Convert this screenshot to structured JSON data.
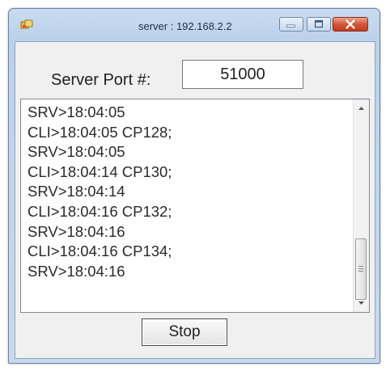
{
  "window": {
    "title": "server : 192.168.2.2",
    "icons": {
      "app": "app-icon",
      "minimize": "minimize-icon",
      "maximize": "maximize-icon",
      "close": "close-icon"
    }
  },
  "port": {
    "label": "Server Port #:",
    "value": "51000"
  },
  "log": {
    "lines": [
      "SRV>18:04:05",
      "CLI>18:04:05 CP128;",
      "SRV>18:04:05",
      "CLI>18:04:14 CP130;",
      "SRV>18:04:14",
      "CLI>18:04:16 CP132;",
      "SRV>18:04:16",
      "CLI>18:04:16 CP134;",
      "SRV>18:04:16"
    ]
  },
  "buttons": {
    "stop_label": "Stop"
  },
  "colors": {
    "title_bar": "#bcd2ea",
    "close_button": "#c8462a",
    "client_background": "#f0f0f0"
  }
}
